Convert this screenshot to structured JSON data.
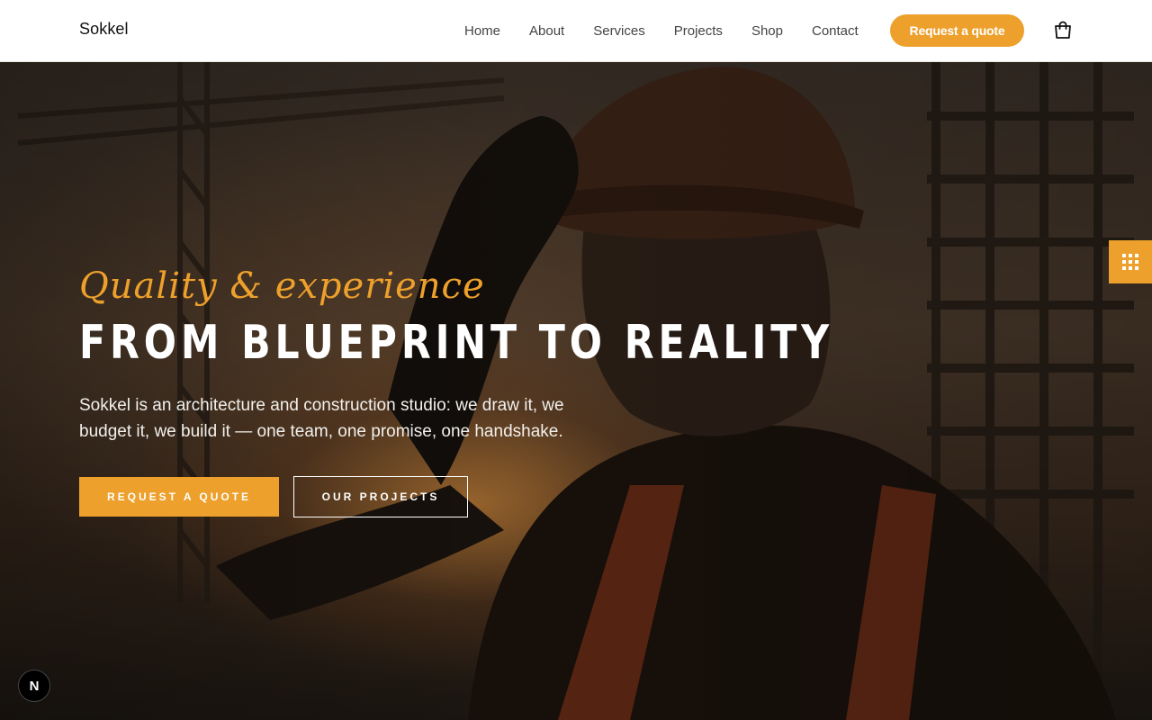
{
  "header": {
    "brand": "Sokkel",
    "nav": [
      "Home",
      "About",
      "Services",
      "Projects",
      "Shop",
      "Contact"
    ],
    "quote_button": "Request a quote",
    "cart_icon": "shopping-bag-icon"
  },
  "hero": {
    "script_title": "Quality & experience",
    "title": "FROM BLUEPRINT TO REALITY",
    "lead": "Sokkel is an architecture and construction studio: we draw it, we budget it, we build it — one team, one promise, one handshake.",
    "primary_button": "REQUEST A QUOTE",
    "secondary_button": "OUR PROJECTS",
    "side_tab_icon": "grid-dots-icon"
  },
  "badge": {
    "label": "N"
  },
  "colors": {
    "accent": "#eda02c",
    "header_bg": "#ffffff",
    "text_dark": "#111111"
  }
}
